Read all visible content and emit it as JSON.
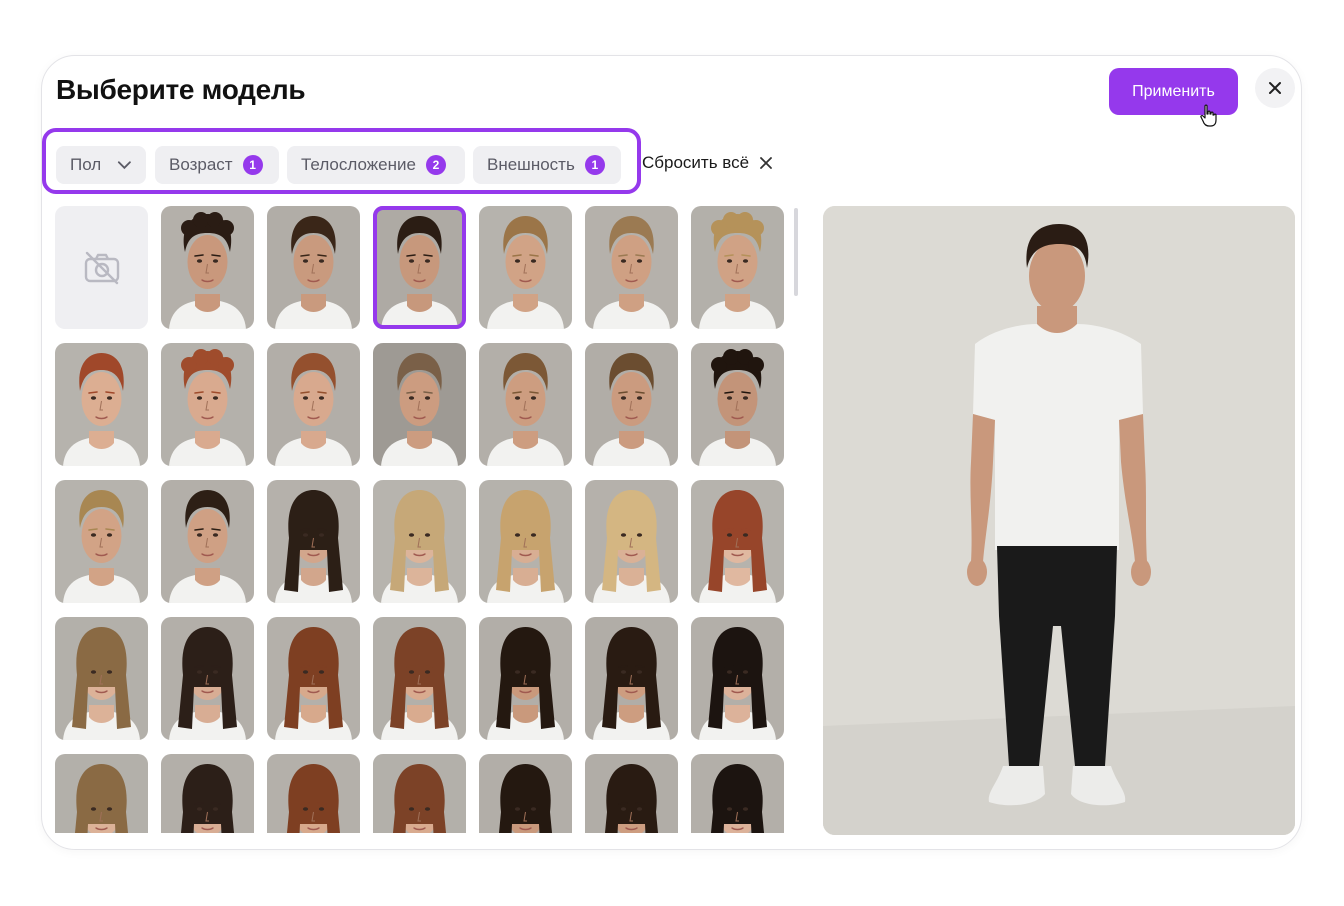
{
  "modal": {
    "title": "Выберите модель",
    "apply_label": "Применить",
    "close_icon": "close-icon"
  },
  "filters": {
    "gender": {
      "label": "Пол",
      "icon": "chevron-down-icon"
    },
    "age": {
      "label": "Возраст",
      "count": "1"
    },
    "build": {
      "label": "Телосложение",
      "count": "2"
    },
    "appearance": {
      "label": "Внешность",
      "count": "1"
    },
    "reset_label": "Сбросить всё"
  },
  "colors": {
    "accent": "#9539ec",
    "chip_bg": "#efeff2"
  },
  "models": [
    {
      "type": "empty",
      "icon": "no-photo-icon"
    },
    {
      "hair": "#2a1c14",
      "skin": "#c9987c",
      "bg": "#b4b0aa",
      "curly": true
    },
    {
      "hair": "#3a2618",
      "skin": "#c99a7e",
      "bg": "#b1ada7",
      "curly": false
    },
    {
      "hair": "#2b1d14",
      "skin": "#c7987c",
      "bg": "#aeaaa4",
      "curly": false,
      "selected": true
    },
    {
      "hair": "#9b7548",
      "skin": "#d1a386",
      "bg": "#b6b3ad",
      "curly": false
    },
    {
      "hair": "#9b7a52",
      "skin": "#cfa083",
      "bg": "#b5b1ab",
      "curly": false
    },
    {
      "hair": "#b5925a",
      "skin": "#d0a285",
      "bg": "#b3b0aa",
      "curly": true
    },
    {
      "hair": "#a0482a",
      "skin": "#dcae92",
      "bg": "#b6b3ad",
      "curly": false
    },
    {
      "hair": "#9f4c2c",
      "skin": "#d9aa8f",
      "bg": "#b4b1ab",
      "curly": true
    },
    {
      "hair": "#94502e",
      "skin": "#d8a98e",
      "bg": "#b2aea8",
      "curly": false
    },
    {
      "hair": "#7a6048",
      "skin": "#cc9c80",
      "bg": "#9e9a94",
      "curly": false
    },
    {
      "hair": "#7c5836",
      "skin": "#cd9d80",
      "bg": "#b3afa9",
      "curly": false
    },
    {
      "hair": "#6b4d30",
      "skin": "#cb9b7f",
      "bg": "#b1ada7",
      "curly": false
    },
    {
      "hair": "#20150e",
      "skin": "#c39479",
      "bg": "#b3afa9",
      "curly": true
    },
    {
      "hair": "#a88752",
      "skin": "#d2a386",
      "bg": "#b6b3ad",
      "curly": false
    },
    {
      "hair": "#2d1f15",
      "skin": "#cfa084",
      "bg": "#b3afa9",
      "curly": false
    },
    {
      "hair": "#2c1f16",
      "skin": "#d2a68c",
      "bg": "#b5b1ab",
      "curly": false,
      "long": true
    },
    {
      "hair": "#c6a878",
      "skin": "#dcb49a",
      "bg": "#b7b4ae",
      "curly": false,
      "long": true
    },
    {
      "hair": "#c7a36e",
      "skin": "#d8ae93",
      "bg": "#b5b2ac",
      "curly": true,
      "long": true
    },
    {
      "hair": "#d4b682",
      "skin": "#dab196",
      "bg": "#b5b1ab",
      "curly": true,
      "long": true
    },
    {
      "hair": "#97452a",
      "skin": "#e0b8a0",
      "bg": "#b6b3ad",
      "curly": false,
      "long": true
    },
    {
      "hair": "#8a6a44",
      "skin": "#dcb298",
      "bg": "#b3b0aa",
      "curly": true,
      "long": true
    },
    {
      "hair": "#2c1f18",
      "skin": "#d8ad94",
      "bg": "#b3afa9",
      "curly": false,
      "long": true
    },
    {
      "hair": "#7e3f22",
      "skin": "#d7a98c",
      "bg": "#b4b0aa",
      "curly": true,
      "long": true
    },
    {
      "hair": "#7c4227",
      "skin": "#d9ab8f",
      "bg": "#b3b0aa",
      "curly": false,
      "long": true
    },
    {
      "hair": "#241810",
      "skin": "#c9997c",
      "bg": "#b2aea8",
      "curly": true,
      "long": true
    },
    {
      "hair": "#291b12",
      "skin": "#cd9d80",
      "bg": "#b1ada7",
      "curly": true,
      "long": true
    },
    {
      "hair": "#1c1410",
      "skin": "#dcb29a",
      "bg": "#b3afa9",
      "curly": false,
      "long": true
    },
    {
      "hair": "#8a6a44",
      "skin": "#dcb298",
      "bg": "#b3b0aa",
      "curly": true,
      "long": true
    },
    {
      "hair": "#2c1f18",
      "skin": "#d8ad94",
      "bg": "#b3afa9",
      "curly": false,
      "long": true
    },
    {
      "hair": "#7e3f22",
      "skin": "#d7a98c",
      "bg": "#b4b0aa",
      "curly": true,
      "long": true
    },
    {
      "hair": "#7c4227",
      "skin": "#d9ab8f",
      "bg": "#b3b0aa",
      "curly": false,
      "long": true
    },
    {
      "hair": "#241810",
      "skin": "#c9997c",
      "bg": "#b2aea8",
      "curly": true,
      "long": true
    },
    {
      "hair": "#291b12",
      "skin": "#cd9d80",
      "bg": "#b1ada7",
      "curly": true,
      "long": true
    },
    {
      "hair": "#1c1410",
      "skin": "#dcb29a",
      "bg": "#b3afa9",
      "curly": false,
      "long": true
    }
  ],
  "preview": {
    "hair": "#2a1c14",
    "skin": "#c9987c",
    "shirt": "#f1f1ef",
    "pants": "#1a1a1a",
    "shoes": "#ececea",
    "bg": "#dcdad4"
  }
}
